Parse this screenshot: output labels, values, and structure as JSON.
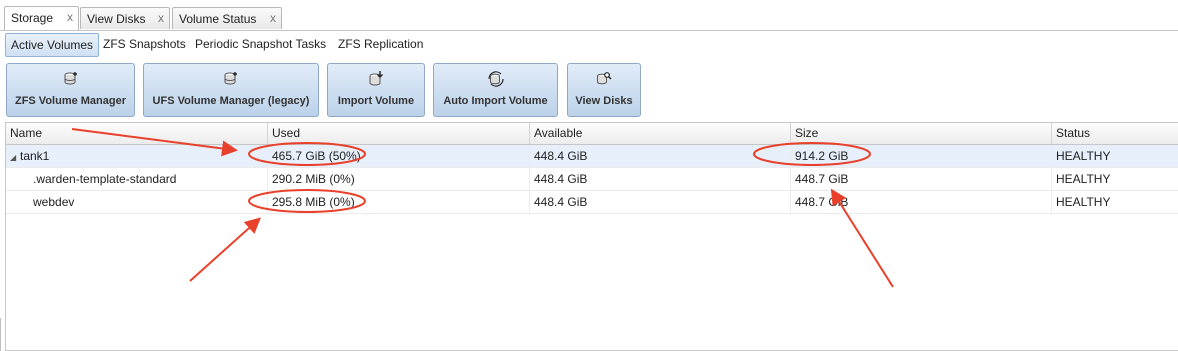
{
  "tabs": [
    {
      "label": "Storage",
      "close": "x",
      "active": true
    },
    {
      "label": "View Disks",
      "close": "x",
      "active": false
    },
    {
      "label": "Volume Status",
      "close": "x",
      "active": false
    }
  ],
  "subnav": [
    {
      "label": "Active Volumes",
      "active": true
    },
    {
      "label": "ZFS Snapshots",
      "active": false
    },
    {
      "label": "Periodic Snapshot Tasks",
      "active": false
    },
    {
      "label": "ZFS Replication",
      "active": false
    }
  ],
  "toolbar": [
    {
      "label": "ZFS Volume Manager",
      "icon": "database-add-icon"
    },
    {
      "label": "UFS Volume Manager (legacy)",
      "icon": "database-add-icon"
    },
    {
      "label": "Import Volume",
      "icon": "database-import-icon"
    },
    {
      "label": "Auto Import Volume",
      "icon": "database-refresh-icon"
    },
    {
      "label": "View Disks",
      "icon": "database-search-icon"
    }
  ],
  "grid": {
    "columns": [
      "Name",
      "Used",
      "Available",
      "Size",
      "Status"
    ],
    "rows": [
      {
        "name": "tank1",
        "expanded": true,
        "used": "465.7 GiB (50%)",
        "available": "448.4 GiB",
        "size": "914.2 GiB",
        "status": "HEALTHY"
      },
      {
        "name": ".warden-template-standard",
        "used": "290.2 MiB (0%)",
        "available": "448.4 GiB",
        "size": "448.7 GiB",
        "status": "HEALTHY"
      },
      {
        "name": "webdev",
        "used": "295.8 MiB (0%)",
        "available": "448.4 GiB",
        "size": "448.7 GiB",
        "status": "HEALTHY"
      }
    ]
  },
  "colors": {
    "accent": "#8fb2d6",
    "annotation": "#e8402a",
    "selected_row": "#e6effa"
  }
}
